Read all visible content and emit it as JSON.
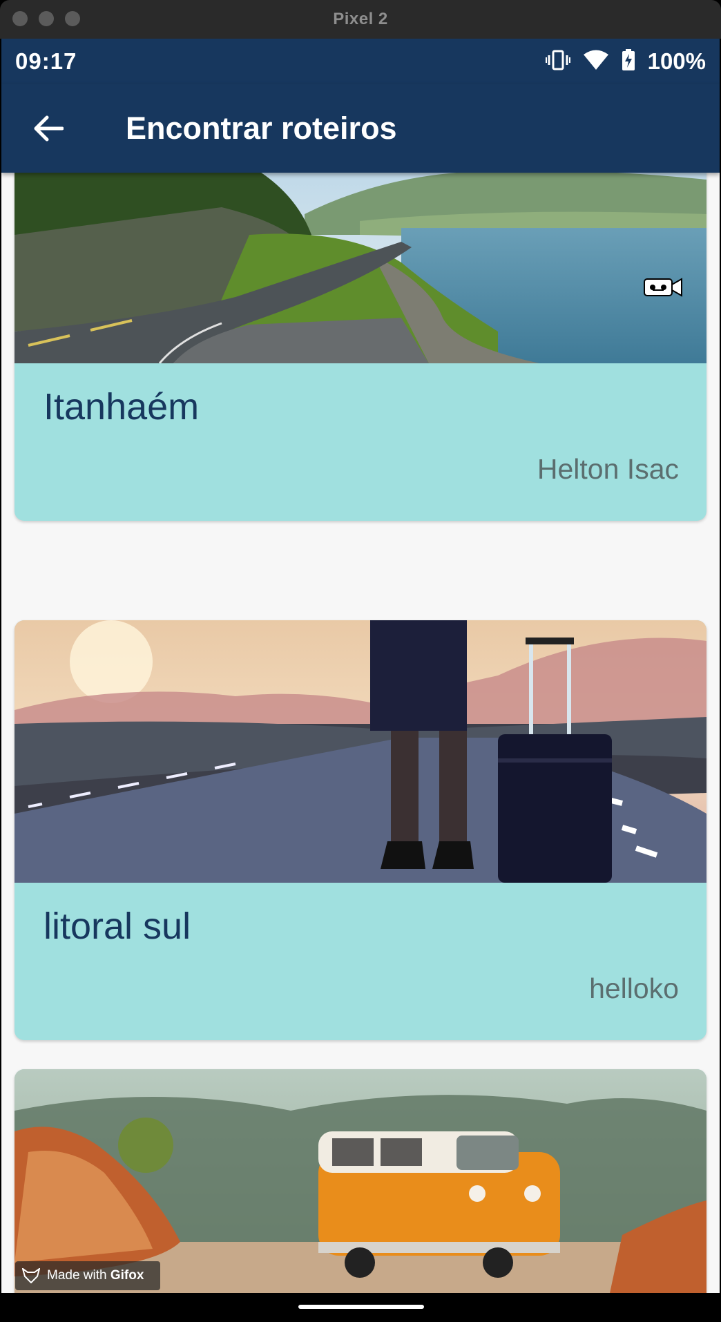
{
  "window": {
    "title": "Pixel 2"
  },
  "status_bar": {
    "time": "09:17",
    "battery": "100%",
    "icons": [
      "vibrate-icon",
      "wifi-icon",
      "battery-charging-icon"
    ]
  },
  "app_bar": {
    "title": "Encontrar roteiros",
    "back_icon": "arrow-back-icon"
  },
  "routes": [
    {
      "title": "Itanhaém",
      "author": "Helton Isac",
      "image": "coastal-road-photo",
      "badge_icon": "video-camera-icon"
    },
    {
      "title": "litoral sul",
      "author": "helloko",
      "image": "traveler-suitcase-road-photo"
    },
    {
      "title": "",
      "author": "",
      "image": "orange-van-desert-photo"
    }
  ],
  "watermark": {
    "prefix": "Made with ",
    "brand": "Gifox"
  },
  "colors": {
    "app_bar": "#17375e",
    "card": "#a0e0df",
    "title_text": "#17375e",
    "author_text": "#5b6e6f"
  }
}
